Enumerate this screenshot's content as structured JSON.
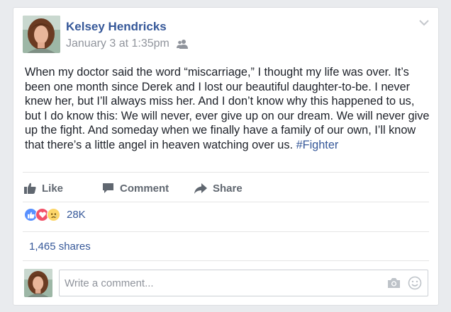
{
  "post": {
    "author": "Kelsey Hendricks",
    "timestamp": "January 3 at 1:35pm",
    "audience_icon": "friends-icon",
    "text": "When my doctor said the word “miscarriage,” I thought my life was over. It’s been one month since Derek and I lost our beautiful daughter-to-be. I never knew her, but I’ll always miss her. And I don’t know why this happened to us, but I do know this: We will never, ever give up on our dream. We will never give up the fight. And someday when we finally have a family of our own, I’ll know that there’s a little angel in heaven watching over us.",
    "hashtag": "#Fighter"
  },
  "actions": {
    "like": "Like",
    "comment": "Comment",
    "share": "Share"
  },
  "reactions": {
    "types": [
      "like",
      "love",
      "sad"
    ],
    "count": "28K"
  },
  "shares": "1,465 shares",
  "comment_box": {
    "placeholder": "Write a comment..."
  },
  "colors": {
    "link_blue": "#365899",
    "like_blue": "#5890ff",
    "love_red": "#f25268",
    "sad_yellow": "#fcd669",
    "muted_gray": "#90949c"
  }
}
